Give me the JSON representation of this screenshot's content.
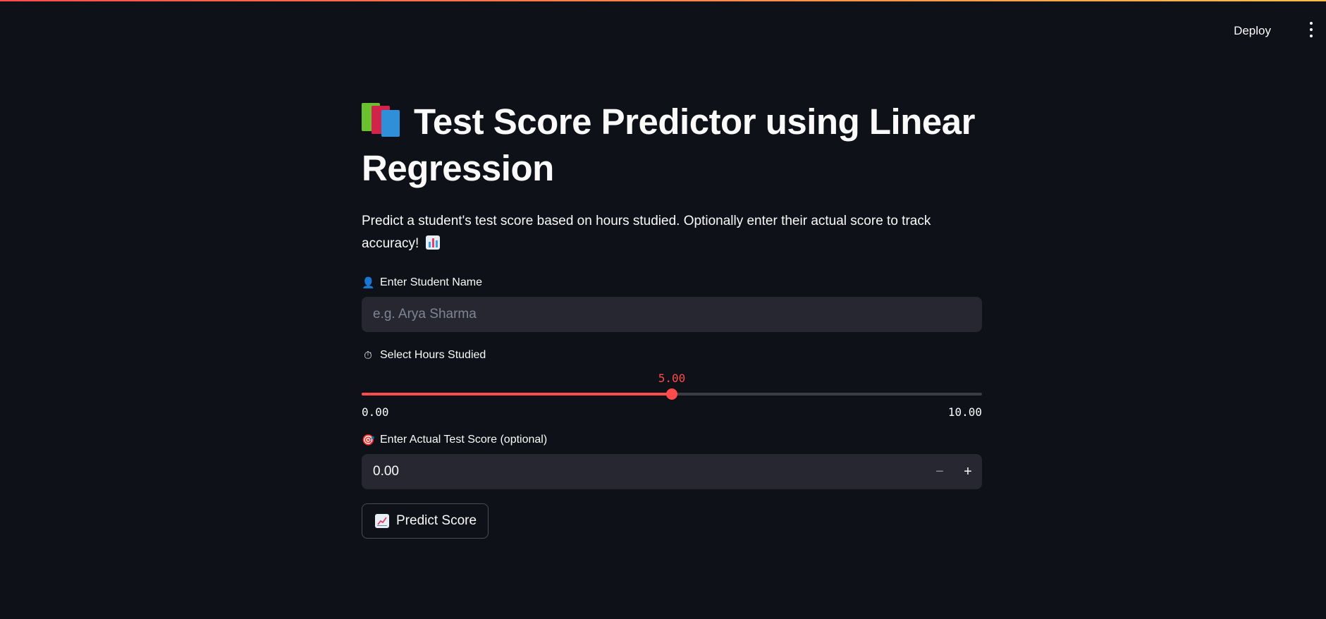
{
  "header": {
    "deploy_label": "Deploy",
    "menu_icon": "kebab-menu-icon"
  },
  "main": {
    "title": "Test Score Predictor using Linear Regression",
    "title_icon": "books-icon",
    "description": "Predict a student's test score based on hours studied. Optionally enter their actual score to track accuracy!",
    "description_icon": "bar-chart-icon"
  },
  "name_field": {
    "icon": "👤",
    "label": "Enter Student Name",
    "placeholder": "e.g. Arya Sharma",
    "value": ""
  },
  "hours_slider": {
    "icon": "⏱",
    "label": "Select Hours Studied",
    "value": "5.00",
    "min": "0.00",
    "max": "10.00",
    "fraction": 0.5
  },
  "score_field": {
    "icon": "🎯",
    "label": "Enter Actual Test Score (optional)",
    "value": "0.00",
    "minus_label": "−",
    "plus_label": "+"
  },
  "predict_button": {
    "icon": "chart-increasing-icon",
    "label": "Predict Score"
  },
  "colors": {
    "background": "#0e1117",
    "accent": "#ff4b4b",
    "input_bg": "#262730"
  }
}
